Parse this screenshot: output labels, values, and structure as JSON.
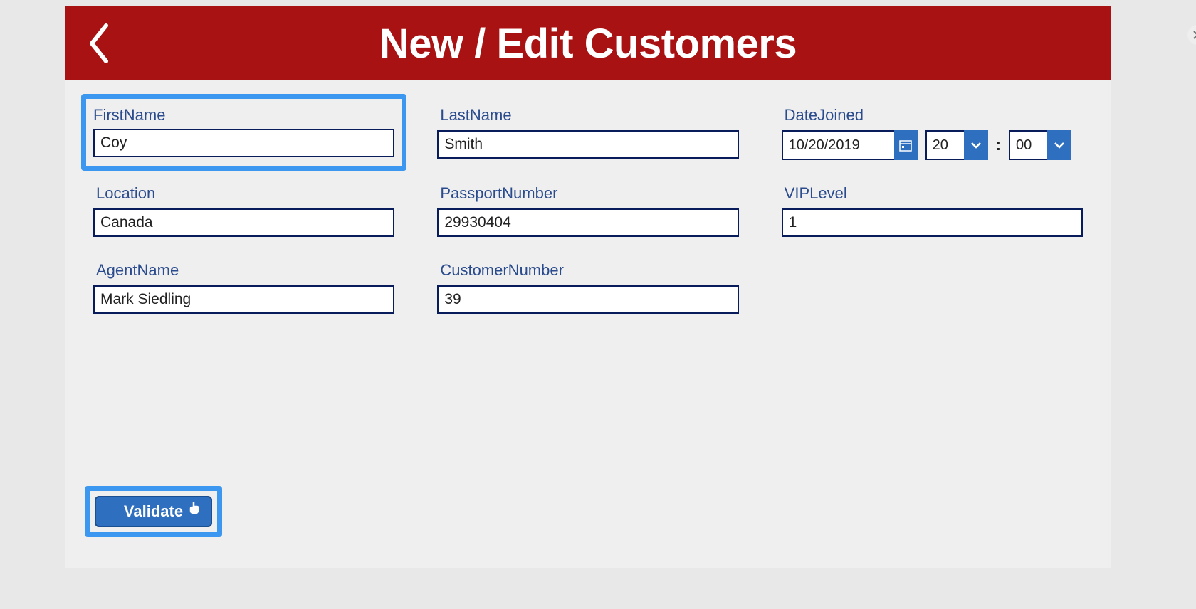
{
  "header": {
    "title": "New / Edit Customers"
  },
  "form": {
    "firstName": {
      "label": "FirstName",
      "value": "Coy"
    },
    "lastName": {
      "label": "LastName",
      "value": "Smith"
    },
    "dateJoined": {
      "label": "DateJoined",
      "date": "10/20/2019",
      "hour": "20",
      "minute": "00"
    },
    "location": {
      "label": "Location",
      "value": "Canada"
    },
    "passportNumber": {
      "label": "PassportNumber",
      "value": "29930404"
    },
    "vipLevel": {
      "label": "VIPLevel",
      "value": "1"
    },
    "agentName": {
      "label": "AgentName",
      "value": "Mark Siedling"
    },
    "customerNumber": {
      "label": "CustomerNumber",
      "value": "39"
    }
  },
  "buttons": {
    "validate": "Validate"
  },
  "colors": {
    "headerBg": "#a81212",
    "highlightBorder": "#3b97f0",
    "inputBorder": "#081c5b",
    "dropdownBg": "#2f6fbf",
    "labelColor": "#2a4b8d"
  }
}
